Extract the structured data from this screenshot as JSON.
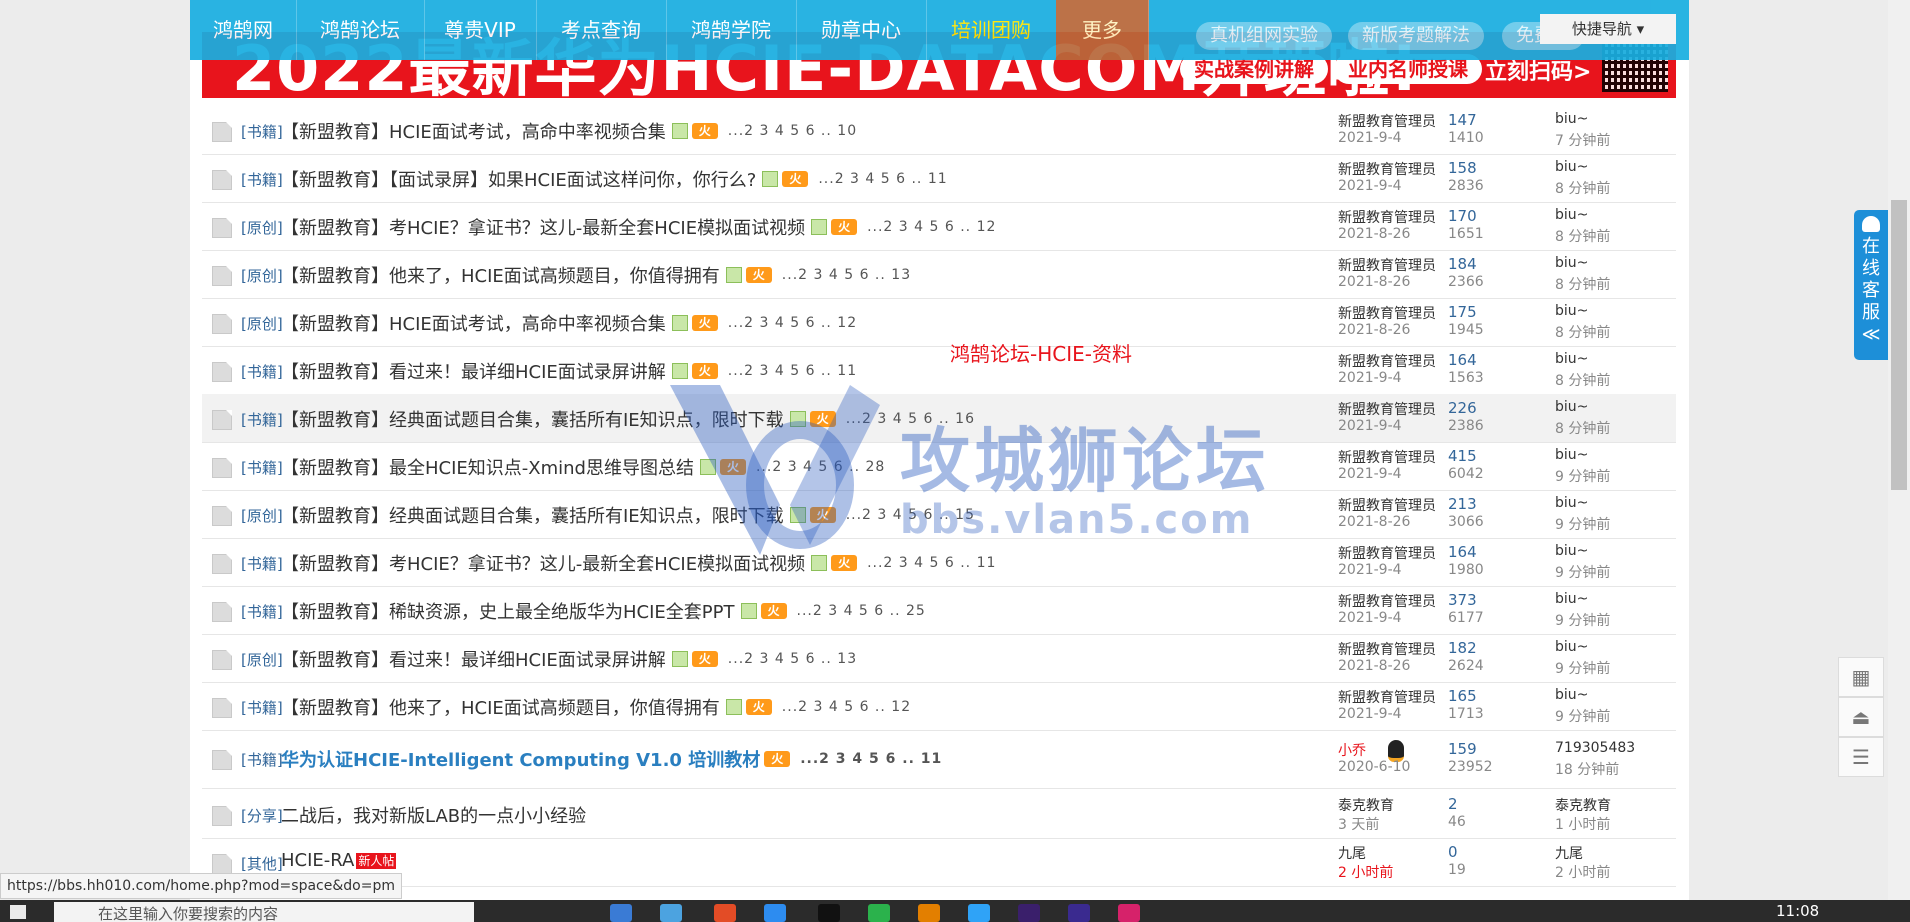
{
  "nav": {
    "items": [
      {
        "label": "鸿鹄网",
        "style": "normal"
      },
      {
        "label": "鸿鹄论坛",
        "style": "normal"
      },
      {
        "label": "尊贵VIP",
        "style": "normal"
      },
      {
        "label": "考点查询",
        "style": "normal"
      },
      {
        "label": "鸿鹄学院",
        "style": "normal"
      },
      {
        "label": "勋章中心",
        "style": "normal"
      },
      {
        "label": "培训团购",
        "style": "highlight"
      },
      {
        "label": "更多",
        "style": "more"
      }
    ],
    "ghost_buttons": [
      "真机组网实验",
      "新版考题解法",
      "免费讲"
    ],
    "quick_nav": "快捷导航 ▾"
  },
  "banner": {
    "title": "2022最新华为HCIE-DATACOM开班啦!",
    "buttons": [
      "实战案例讲解",
      "业内名师授课"
    ],
    "scan": "立刻扫码>"
  },
  "overlay_label": "鸿鹄论坛-HCIE-资料",
  "watermark": {
    "main": "攻城狮论坛",
    "sub": "bbs.vlan5.com"
  },
  "threads": [
    {
      "category": "[书籍]",
      "title": "【新盟教育】HCIE面试考试，高命中率视频合集",
      "attach": true,
      "hot": true,
      "pages": "...2 3 4 5 6 .. 10",
      "author": "新盟教育管理员",
      "date": "2021-9-4",
      "replies": "147",
      "views": "1410",
      "last_user": "biu~",
      "last_time": "7 分钟前"
    },
    {
      "category": "[书籍]",
      "title": "【新盟教育】【面试录屏】如果HCIE面试这样问你，你行么?",
      "attach": true,
      "hot": true,
      "pages": "...2 3 4 5 6 .. 11",
      "author": "新盟教育管理员",
      "date": "2021-9-4",
      "replies": "158",
      "views": "2836",
      "last_user": "biu~",
      "last_time": "8 分钟前"
    },
    {
      "category": "[原创]",
      "title": "【新盟教育】考HCIE？拿证书？这儿-最新全套HCIE模拟面试视频",
      "attach": true,
      "hot": true,
      "pages": "...2 3 4 5 6 .. 12",
      "author": "新盟教育管理员",
      "date": "2021-8-26",
      "replies": "170",
      "views": "1651",
      "last_user": "biu~",
      "last_time": "8 分钟前"
    },
    {
      "category": "[原创]",
      "title": "【新盟教育】他来了，HCIE面试高频题目，你值得拥有",
      "attach": true,
      "hot": true,
      "pages": "...2 3 4 5 6 .. 13",
      "author": "新盟教育管理员",
      "date": "2021-8-26",
      "replies": "184",
      "views": "2366",
      "last_user": "biu~",
      "last_time": "8 分钟前"
    },
    {
      "category": "[原创]",
      "title": "【新盟教育】HCIE面试考试，高命中率视频合集",
      "attach": true,
      "hot": true,
      "pages": "...2 3 4 5 6 .. 12",
      "author": "新盟教育管理员",
      "date": "2021-8-26",
      "replies": "175",
      "views": "1945",
      "last_user": "biu~",
      "last_time": "8 分钟前"
    },
    {
      "category": "[书籍]",
      "title": "【新盟教育】看过来！最详细HCIE面试录屏讲解",
      "attach": true,
      "hot": true,
      "pages": "...2 3 4 5 6 .. 11",
      "author": "新盟教育管理员",
      "date": "2021-9-4",
      "replies": "164",
      "views": "1563",
      "last_user": "biu~",
      "last_time": "8 分钟前"
    },
    {
      "category": "[书籍]",
      "title": "【新盟教育】经典面试题目合集，囊括所有IE知识点，限时下载",
      "attach": true,
      "hot": true,
      "pages": "...2 3 4 5 6 .. 16",
      "author": "新盟教育管理员",
      "date": "2021-9-4",
      "replies": "226",
      "views": "2386",
      "last_user": "biu~",
      "last_time": "8 分钟前"
    },
    {
      "category": "[书籍]",
      "title": "【新盟教育】最全HCIE知识点-Xmind思维导图总结",
      "attach": true,
      "hot": true,
      "pages": "...2 3 4 5 6 .. 28",
      "author": "新盟教育管理员",
      "date": "2021-9-4",
      "replies": "415",
      "views": "6042",
      "last_user": "biu~",
      "last_time": "9 分钟前"
    },
    {
      "category": "[原创]",
      "title": "【新盟教育】经典面试题目合集，囊括所有IE知识点，限时下载",
      "attach": true,
      "hot": true,
      "pages": "...2 3 4 5 6 .. 15",
      "author": "新盟教育管理员",
      "date": "2021-8-26",
      "replies": "213",
      "views": "3066",
      "last_user": "biu~",
      "last_time": "9 分钟前"
    },
    {
      "category": "[书籍]",
      "title": "【新盟教育】考HCIE？拿证书？这儿-最新全套HCIE模拟面试视频",
      "attach": true,
      "hot": true,
      "pages": "...2 3 4 5 6 .. 11",
      "author": "新盟教育管理员",
      "date": "2021-9-4",
      "replies": "164",
      "views": "1980",
      "last_user": "biu~",
      "last_time": "9 分钟前"
    },
    {
      "category": "[书籍]",
      "title": "【新盟教育】稀缺资源，史上最全绝版华为HCIE全套PPT",
      "attach": true,
      "hot": true,
      "pages": "...2 3 4 5 6 .. 25",
      "author": "新盟教育管理员",
      "date": "2021-9-4",
      "replies": "373",
      "views": "6177",
      "last_user": "biu~",
      "last_time": "9 分钟前"
    },
    {
      "category": "[原创]",
      "title": "【新盟教育】看过来！最详细HCIE面试录屏讲解",
      "attach": true,
      "hot": true,
      "pages": "...2 3 4 5 6 .. 13",
      "author": "新盟教育管理员",
      "date": "2021-8-26",
      "replies": "182",
      "views": "2624",
      "last_user": "biu~",
      "last_time": "9 分钟前"
    },
    {
      "category": "[书籍]",
      "title": "【新盟教育】他来了，HCIE面试高频题目，你值得拥有",
      "attach": true,
      "hot": true,
      "pages": "...2 3 4 5 6 .. 12",
      "author": "新盟教育管理员",
      "date": "2021-9-4",
      "replies": "165",
      "views": "1713",
      "last_user": "biu~",
      "last_time": "9 分钟前"
    },
    {
      "category": "[书籍]",
      "title": "华为认证HCIE-Intelligent Computing V1.0 培训教材",
      "attach": false,
      "hot": true,
      "bold": true,
      "pages": "...2 3 4 5 6 .. 11",
      "author": "小乔",
      "author_red": true,
      "penguin": true,
      "date": "2020-6-10",
      "replies": "159",
      "views": "23952",
      "last_user": "719305483",
      "last_time": "18 分钟前"
    },
    {
      "category": "[分享]",
      "title": "二战后，我对新版LAB的一点小小经验",
      "attach": false,
      "hot": false,
      "pages": "",
      "author": "泰克教育",
      "date": "3 天前",
      "replies": "2",
      "views": "46",
      "last_user": "泰克教育",
      "last_time": "1 小时前"
    },
    {
      "category": "[其他]",
      "title": "HCIE-RA",
      "attach": false,
      "hot": false,
      "newtag": "新人帖",
      "pages": "",
      "author": "九尾",
      "date": "2 小时前",
      "date_red": true,
      "replies": "0",
      "views": "19",
      "last_user": "九尾",
      "last_time": "2 小时前"
    }
  ],
  "hot_icon_text": "火",
  "support": {
    "chars": [
      "在",
      "线",
      "客",
      "服",
      "≪"
    ]
  },
  "side_buttons": [
    "qr-code-icon",
    "back-to-top-icon",
    "list-icon"
  ],
  "status_url": "https://bbs.hh010.com/home.php?mod=space&do=pm",
  "taskbar": {
    "search_placeholder": "在这里输入你要搜索的内容",
    "time": "11:08"
  }
}
